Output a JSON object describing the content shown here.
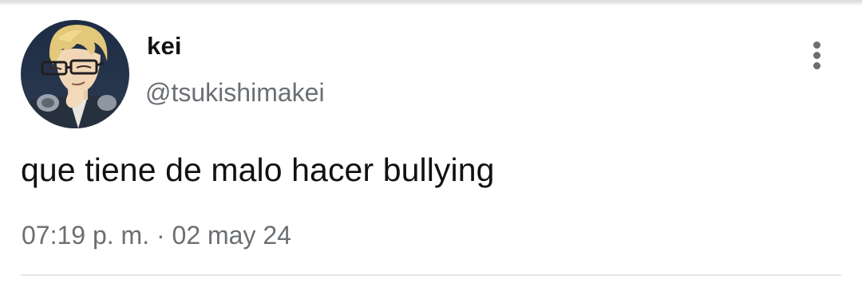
{
  "tweet": {
    "author_name": "kei",
    "author_handle": "@tsukishimakei",
    "text": "que tiene de malo hacer bullying",
    "timestamp": "07:19 p. m. · 02 may 24"
  },
  "icons": {
    "avatar": "profile-picture",
    "more": "more-vertical-icon"
  },
  "colors": {
    "primary_text": "#111111",
    "secondary_text": "#6b6f73",
    "divider": "#e6e6e6"
  }
}
